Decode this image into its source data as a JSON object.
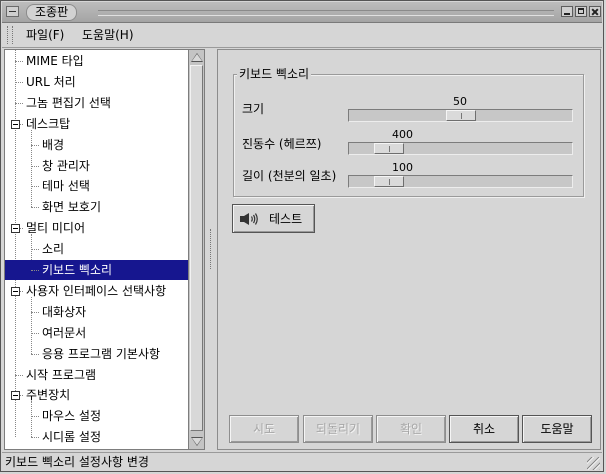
{
  "window": {
    "title": "조종판"
  },
  "menubar": {
    "items": [
      "파일(F)",
      "도움말(H)"
    ]
  },
  "tree": {
    "items": [
      {
        "label": "MIME 타입",
        "level": 0,
        "expander": false
      },
      {
        "label": "URL 처리",
        "level": 0,
        "expander": false
      },
      {
        "label": "그놈 편집기 선택",
        "level": 0,
        "expander": false
      },
      {
        "label": "데스크탑",
        "level": 0,
        "expander": true
      },
      {
        "label": "배경",
        "level": 1,
        "expander": false
      },
      {
        "label": "창 관리자",
        "level": 1,
        "expander": false
      },
      {
        "label": "테마 선택",
        "level": 1,
        "expander": false
      },
      {
        "label": "화면 보호기",
        "level": 1,
        "expander": false
      },
      {
        "label": "멀티 미디어",
        "level": 0,
        "expander": true
      },
      {
        "label": "소리",
        "level": 1,
        "expander": false
      },
      {
        "label": "키보드 삑소리",
        "level": 1,
        "expander": false,
        "selected": true
      },
      {
        "label": "사용자 인터페이스 선택사항",
        "level": 0,
        "expander": true
      },
      {
        "label": "대화상자",
        "level": 1,
        "expander": false
      },
      {
        "label": "여러문서",
        "level": 1,
        "expander": false
      },
      {
        "label": "응용 프로그램 기본사항",
        "level": 1,
        "expander": false
      },
      {
        "label": "시작 프로그램",
        "level": 0,
        "expander": false
      },
      {
        "label": "주변장치",
        "level": 0,
        "expander": true
      },
      {
        "label": "마우스 설정",
        "level": 1,
        "expander": false
      },
      {
        "label": "시디롬 설정",
        "level": 1,
        "expander": false
      }
    ]
  },
  "bell": {
    "frame_title": "키보드 삑소리",
    "sliders": [
      {
        "label": "크기",
        "value": "50",
        "fraction": 0.5
      },
      {
        "label": "진동수 (헤르쯔)",
        "value": "400",
        "fraction": 0.13
      },
      {
        "label": "길이 (천분의 일초)",
        "value": "100",
        "fraction": 0.13
      }
    ],
    "test_button": "테스트",
    "test_icon": "speaker-icon"
  },
  "buttons": {
    "try": "시도",
    "revert": "되돌리기",
    "ok": "확인",
    "cancel": "취소",
    "help": "도움말"
  },
  "status": {
    "text": "키보드 삑소리 설정사항 변경"
  },
  "colors": {
    "selection": "#16168f",
    "background": "#d6d6d6"
  }
}
